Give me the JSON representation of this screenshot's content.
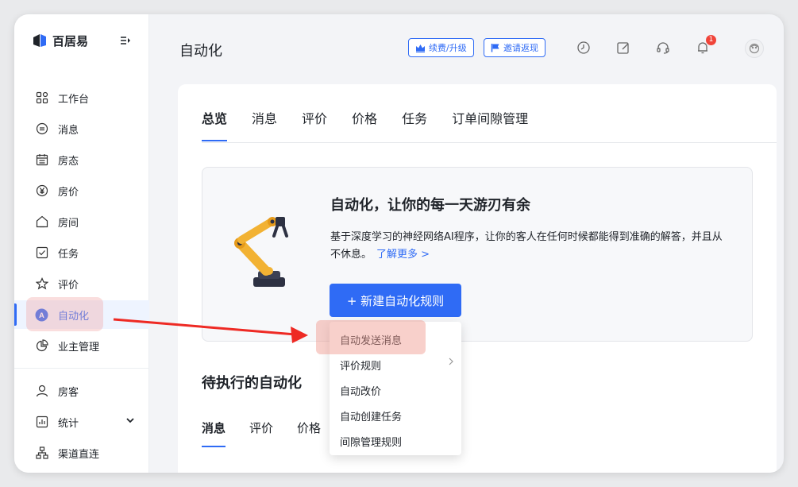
{
  "app": {
    "brand_name": "百居易",
    "page_title": "自动化"
  },
  "sidebar": {
    "items": [
      {
        "label": "工作台",
        "icon": "grid-icon"
      },
      {
        "label": "消息",
        "icon": "chat-icon"
      },
      {
        "label": "房态",
        "icon": "calendar-icon"
      },
      {
        "label": "房价",
        "icon": "yuan-icon"
      },
      {
        "label": "房间",
        "icon": "house-icon"
      },
      {
        "label": "任务",
        "icon": "checkbox-icon"
      },
      {
        "label": "评价",
        "icon": "star-icon"
      },
      {
        "label": "自动化",
        "icon": "automation-icon",
        "active": true
      },
      {
        "label": "业主管理",
        "icon": "pie-icon"
      },
      {
        "label": "房客",
        "icon": "user-icon"
      },
      {
        "label": "统计",
        "icon": "bar-icon"
      },
      {
        "label": "渠道直连",
        "icon": "network-icon"
      }
    ]
  },
  "header": {
    "renew_label": "续费/升级",
    "invite_label": "邀请返现",
    "notification_count": "1"
  },
  "tabs": [
    "总览",
    "消息",
    "评价",
    "价格",
    "任务",
    "订单间隙管理"
  ],
  "promo": {
    "title": "自动化，让你的每一天游刃有余",
    "description": "基于深度学习的神经网络AI程序，让你的客人在任何时候都能得到准确的解答，并且从不休息。",
    "link": "了解更多 >",
    "button": "+ 新建自动化规则"
  },
  "pending": {
    "title": "待执行的自动化",
    "tabs": [
      "消息",
      "评价",
      "价格"
    ]
  },
  "dropdown": {
    "items": [
      "自动发送消息",
      "评价规则",
      "自动改价",
      "自动创建任务",
      "间隙管理规则"
    ]
  },
  "colors": {
    "accent": "#2f6bf5",
    "badge": "#f0443a",
    "highlight": "#f0a0a0",
    "arrow": "#ee2a24"
  }
}
